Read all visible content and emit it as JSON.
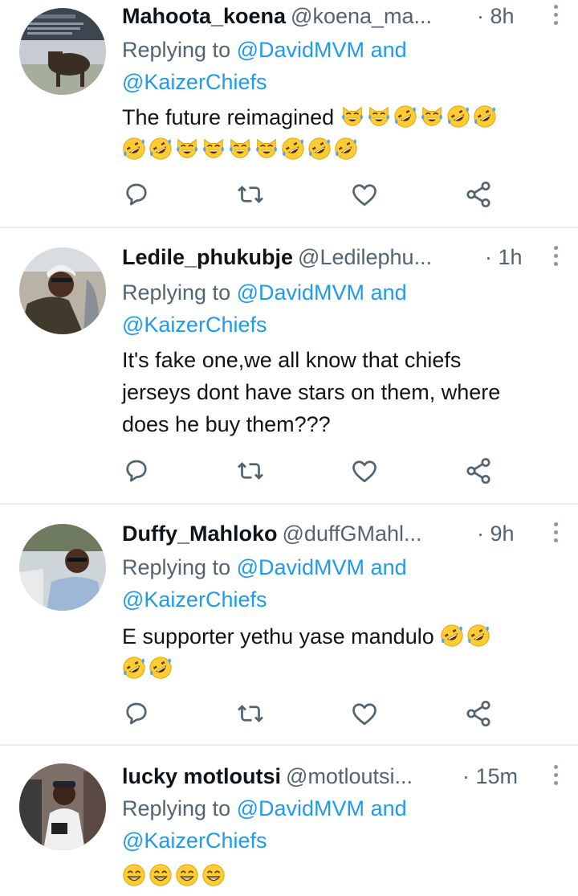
{
  "replying_word": "Replying to",
  "and_word": "and",
  "tweets": [
    {
      "name": "Mahoota_koena",
      "handle": "@koena_ma...",
      "time": "· 8h",
      "mentions": [
        "@DavidMVM",
        "@KaizerChiefs"
      ],
      "text": "The future reimagined",
      "emojis": [
        "joy-cat",
        "joy-cat",
        "rofl",
        "joy-cat",
        "rofl",
        "rofl",
        "rofl",
        "rofl",
        "joy-cat",
        "joy-cat",
        "joy-cat",
        "joy-cat",
        "rofl",
        "rofl",
        "rofl"
      ]
    },
    {
      "name": "Ledile_phukubje",
      "handle": "@Ledilephu...",
      "time": "· 1h",
      "mentions": [
        "@DavidMVM",
        "@KaizerChiefs"
      ],
      "text_lines": [
        "It's fake one,we all know that chiefs",
        "jerseys dont have stars on them, where",
        "does he buy them???"
      ]
    },
    {
      "name": "Duffy_Mahloko",
      "handle": "@duffGMahl...",
      "time": "· 9h",
      "mentions": [
        "@DavidMVM",
        "@KaizerChiefs"
      ],
      "text": "E supporter yethu yase mandulo",
      "emojis": [
        "rofl",
        "rofl",
        "rofl",
        "rofl"
      ]
    },
    {
      "name": "lucky motloutsi",
      "handle": "@motloutsi...",
      "time": "· 15m",
      "mentions": [
        "@DavidMVM",
        "@KaizerChiefs"
      ],
      "emojis": [
        "grin",
        "grin",
        "grin",
        "grin"
      ]
    }
  ],
  "icons": {
    "reply": "speech-bubble-icon",
    "retweet": "retweet-icon",
    "like": "heart-icon",
    "share": "share-icon",
    "more": "vertical-dots-icon"
  },
  "colors": {
    "link": "#1d9bf0",
    "secondary": "#536471",
    "divider": "#e6ecf0"
  }
}
